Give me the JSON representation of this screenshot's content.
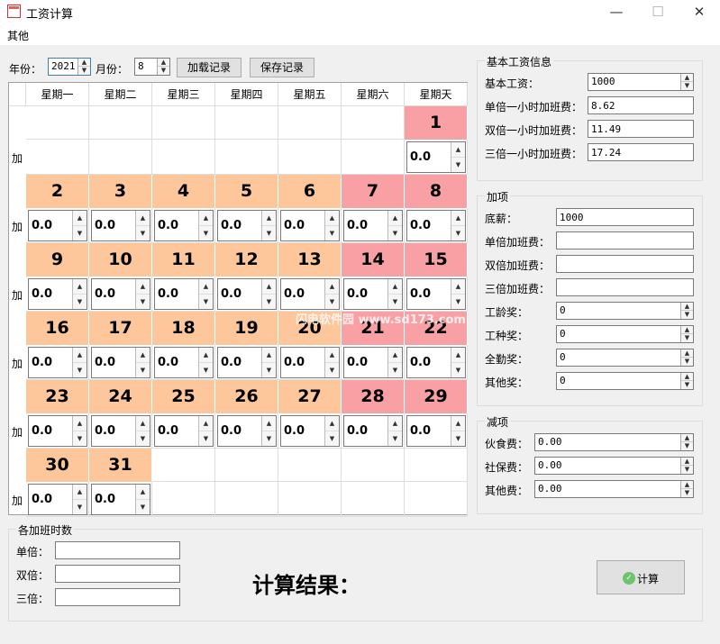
{
  "window": {
    "title": "工资计算",
    "minimize": "—",
    "maximize": "☐",
    "close": "✕"
  },
  "menu": {
    "other": "其他"
  },
  "toolbar": {
    "year_label": "年份：",
    "year_value": "2021",
    "month_label": "月份：",
    "month_value": "8",
    "load_label": "加载记录",
    "save_label": "保存记录"
  },
  "calendar": {
    "weekdays": [
      "星期一",
      "星期二",
      "星期三",
      "星期四",
      "星期五",
      "星期六",
      "星期天"
    ],
    "overtime_label": "加",
    "overtime_value": "0.0",
    "year": 2021,
    "month": 8,
    "first_weekday": 7,
    "days_in_month": 31
  },
  "base_info": {
    "title": "基本工资信息",
    "rows": [
      {
        "label": "基本工资：",
        "value": "1000",
        "type": "spin"
      },
      {
        "label": "单倍一小时加班费：",
        "value": "8.62",
        "type": "text"
      },
      {
        "label": "双倍一小时加班费：",
        "value": "11.49",
        "type": "text"
      },
      {
        "label": "三倍一小时加班费：",
        "value": "17.24",
        "type": "text"
      }
    ]
  },
  "add_items": {
    "title": "加项",
    "rows": [
      {
        "label": "底薪：",
        "value": "1000",
        "type": "text"
      },
      {
        "label": "单倍加班费：",
        "value": "",
        "type": "text"
      },
      {
        "label": "双倍加班费：",
        "value": "",
        "type": "text"
      },
      {
        "label": "三倍加班费：",
        "value": "",
        "type": "text"
      },
      {
        "label": "工龄奖：",
        "value": "0",
        "type": "spin"
      },
      {
        "label": "工种奖：",
        "value": "0",
        "type": "spin"
      },
      {
        "label": "全勤奖：",
        "value": "0",
        "type": "spin"
      },
      {
        "label": "其他奖：",
        "value": "0",
        "type": "spin"
      }
    ]
  },
  "deductions": {
    "title": "减项",
    "rows": [
      {
        "label": "伙食费：",
        "value": "0.00"
      },
      {
        "label": "社保费：",
        "value": "0.00"
      },
      {
        "label": "其他费：",
        "value": "0.00"
      }
    ]
  },
  "ot_hours": {
    "title": "各加班时数",
    "rows": [
      {
        "label": "单倍：",
        "value": ""
      },
      {
        "label": "双倍：",
        "value": ""
      },
      {
        "label": "三倍：",
        "value": ""
      }
    ]
  },
  "result": {
    "label": "计算结果："
  },
  "calc_button": {
    "label": "计算"
  },
  "watermark": "闪电软件园 www.sd173.com",
  "colors": {
    "workday": "#fdc79b",
    "weekend": "#f8a0a3",
    "check_icon": "#6cc46c"
  }
}
